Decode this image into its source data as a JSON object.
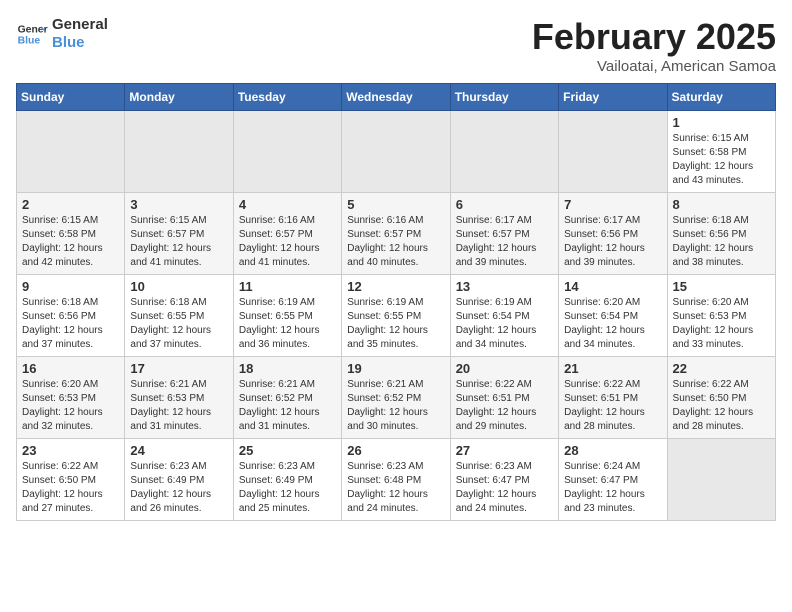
{
  "logo": {
    "line1": "General",
    "line2": "Blue"
  },
  "title": "February 2025",
  "subtitle": "Vailoatai, American Samoa",
  "days_of_week": [
    "Sunday",
    "Monday",
    "Tuesday",
    "Wednesday",
    "Thursday",
    "Friday",
    "Saturday"
  ],
  "weeks": [
    [
      {
        "day": "",
        "info": ""
      },
      {
        "day": "",
        "info": ""
      },
      {
        "day": "",
        "info": ""
      },
      {
        "day": "",
        "info": ""
      },
      {
        "day": "",
        "info": ""
      },
      {
        "day": "",
        "info": ""
      },
      {
        "day": "1",
        "info": "Sunrise: 6:15 AM\nSunset: 6:58 PM\nDaylight: 12 hours and 43 minutes."
      }
    ],
    [
      {
        "day": "2",
        "info": "Sunrise: 6:15 AM\nSunset: 6:58 PM\nDaylight: 12 hours and 42 minutes."
      },
      {
        "day": "3",
        "info": "Sunrise: 6:15 AM\nSunset: 6:57 PM\nDaylight: 12 hours and 41 minutes."
      },
      {
        "day": "4",
        "info": "Sunrise: 6:16 AM\nSunset: 6:57 PM\nDaylight: 12 hours and 41 minutes."
      },
      {
        "day": "5",
        "info": "Sunrise: 6:16 AM\nSunset: 6:57 PM\nDaylight: 12 hours and 40 minutes."
      },
      {
        "day": "6",
        "info": "Sunrise: 6:17 AM\nSunset: 6:57 PM\nDaylight: 12 hours and 39 minutes."
      },
      {
        "day": "7",
        "info": "Sunrise: 6:17 AM\nSunset: 6:56 PM\nDaylight: 12 hours and 39 minutes."
      },
      {
        "day": "8",
        "info": "Sunrise: 6:18 AM\nSunset: 6:56 PM\nDaylight: 12 hours and 38 minutes."
      }
    ],
    [
      {
        "day": "9",
        "info": "Sunrise: 6:18 AM\nSunset: 6:56 PM\nDaylight: 12 hours and 37 minutes."
      },
      {
        "day": "10",
        "info": "Sunrise: 6:18 AM\nSunset: 6:55 PM\nDaylight: 12 hours and 37 minutes."
      },
      {
        "day": "11",
        "info": "Sunrise: 6:19 AM\nSunset: 6:55 PM\nDaylight: 12 hours and 36 minutes."
      },
      {
        "day": "12",
        "info": "Sunrise: 6:19 AM\nSunset: 6:55 PM\nDaylight: 12 hours and 35 minutes."
      },
      {
        "day": "13",
        "info": "Sunrise: 6:19 AM\nSunset: 6:54 PM\nDaylight: 12 hours and 34 minutes."
      },
      {
        "day": "14",
        "info": "Sunrise: 6:20 AM\nSunset: 6:54 PM\nDaylight: 12 hours and 34 minutes."
      },
      {
        "day": "15",
        "info": "Sunrise: 6:20 AM\nSunset: 6:53 PM\nDaylight: 12 hours and 33 minutes."
      }
    ],
    [
      {
        "day": "16",
        "info": "Sunrise: 6:20 AM\nSunset: 6:53 PM\nDaylight: 12 hours and 32 minutes."
      },
      {
        "day": "17",
        "info": "Sunrise: 6:21 AM\nSunset: 6:53 PM\nDaylight: 12 hours and 31 minutes."
      },
      {
        "day": "18",
        "info": "Sunrise: 6:21 AM\nSunset: 6:52 PM\nDaylight: 12 hours and 31 minutes."
      },
      {
        "day": "19",
        "info": "Sunrise: 6:21 AM\nSunset: 6:52 PM\nDaylight: 12 hours and 30 minutes."
      },
      {
        "day": "20",
        "info": "Sunrise: 6:22 AM\nSunset: 6:51 PM\nDaylight: 12 hours and 29 minutes."
      },
      {
        "day": "21",
        "info": "Sunrise: 6:22 AM\nSunset: 6:51 PM\nDaylight: 12 hours and 28 minutes."
      },
      {
        "day": "22",
        "info": "Sunrise: 6:22 AM\nSunset: 6:50 PM\nDaylight: 12 hours and 28 minutes."
      }
    ],
    [
      {
        "day": "23",
        "info": "Sunrise: 6:22 AM\nSunset: 6:50 PM\nDaylight: 12 hours and 27 minutes."
      },
      {
        "day": "24",
        "info": "Sunrise: 6:23 AM\nSunset: 6:49 PM\nDaylight: 12 hours and 26 minutes."
      },
      {
        "day": "25",
        "info": "Sunrise: 6:23 AM\nSunset: 6:49 PM\nDaylight: 12 hours and 25 minutes."
      },
      {
        "day": "26",
        "info": "Sunrise: 6:23 AM\nSunset: 6:48 PM\nDaylight: 12 hours and 24 minutes."
      },
      {
        "day": "27",
        "info": "Sunrise: 6:23 AM\nSunset: 6:47 PM\nDaylight: 12 hours and 24 minutes."
      },
      {
        "day": "28",
        "info": "Sunrise: 6:24 AM\nSunset: 6:47 PM\nDaylight: 12 hours and 23 minutes."
      },
      {
        "day": "",
        "info": ""
      }
    ]
  ]
}
